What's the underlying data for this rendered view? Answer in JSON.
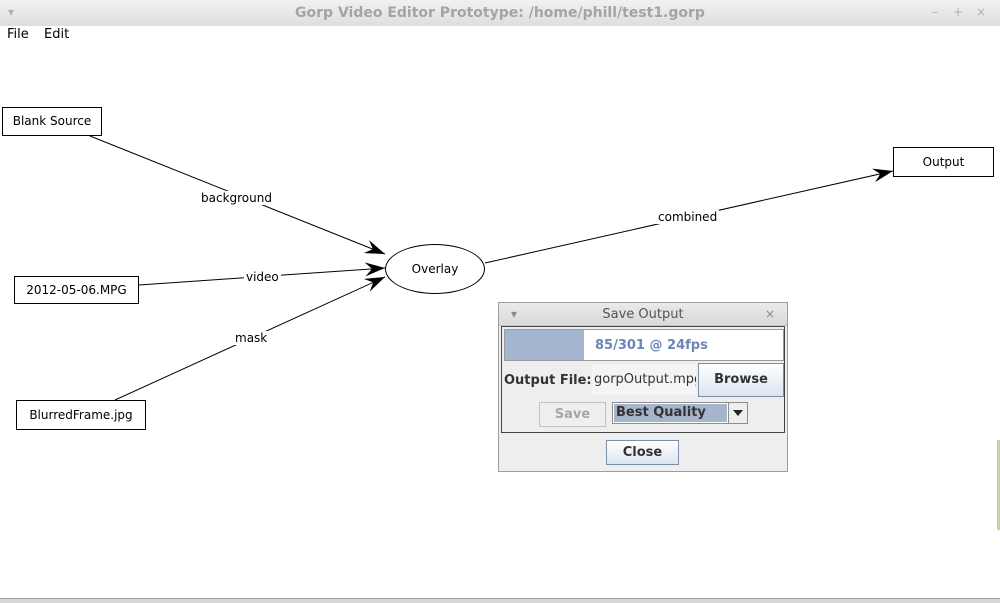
{
  "window": {
    "title": "Gorp Video Editor Prototype: /home/phill/test1.gorp",
    "menu_icon": "chevron-down-icon",
    "controls": [
      "minimize-icon",
      "maximize-icon",
      "close-icon"
    ]
  },
  "menubar": {
    "file": "File",
    "edit": "Edit"
  },
  "graph": {
    "nodes": {
      "blank_source": "Blank Source",
      "mpg": "2012-05-06.MPG",
      "blurred": "BlurredFrame.jpg",
      "overlay": "Overlay",
      "output": "Output"
    },
    "edges": {
      "background": "background",
      "video": "video",
      "mask": "mask",
      "combined": "combined"
    }
  },
  "dialog": {
    "title": "Save Output",
    "progress_text": "85/301 @ 24fps",
    "progress_fraction": 0.2824,
    "output_label": "Output File:",
    "output_value": "gorpOutput.mpg",
    "browse_label": "Browse",
    "save_label": "Save",
    "quality_value": "Best Quality",
    "close_label": "Close"
  }
}
